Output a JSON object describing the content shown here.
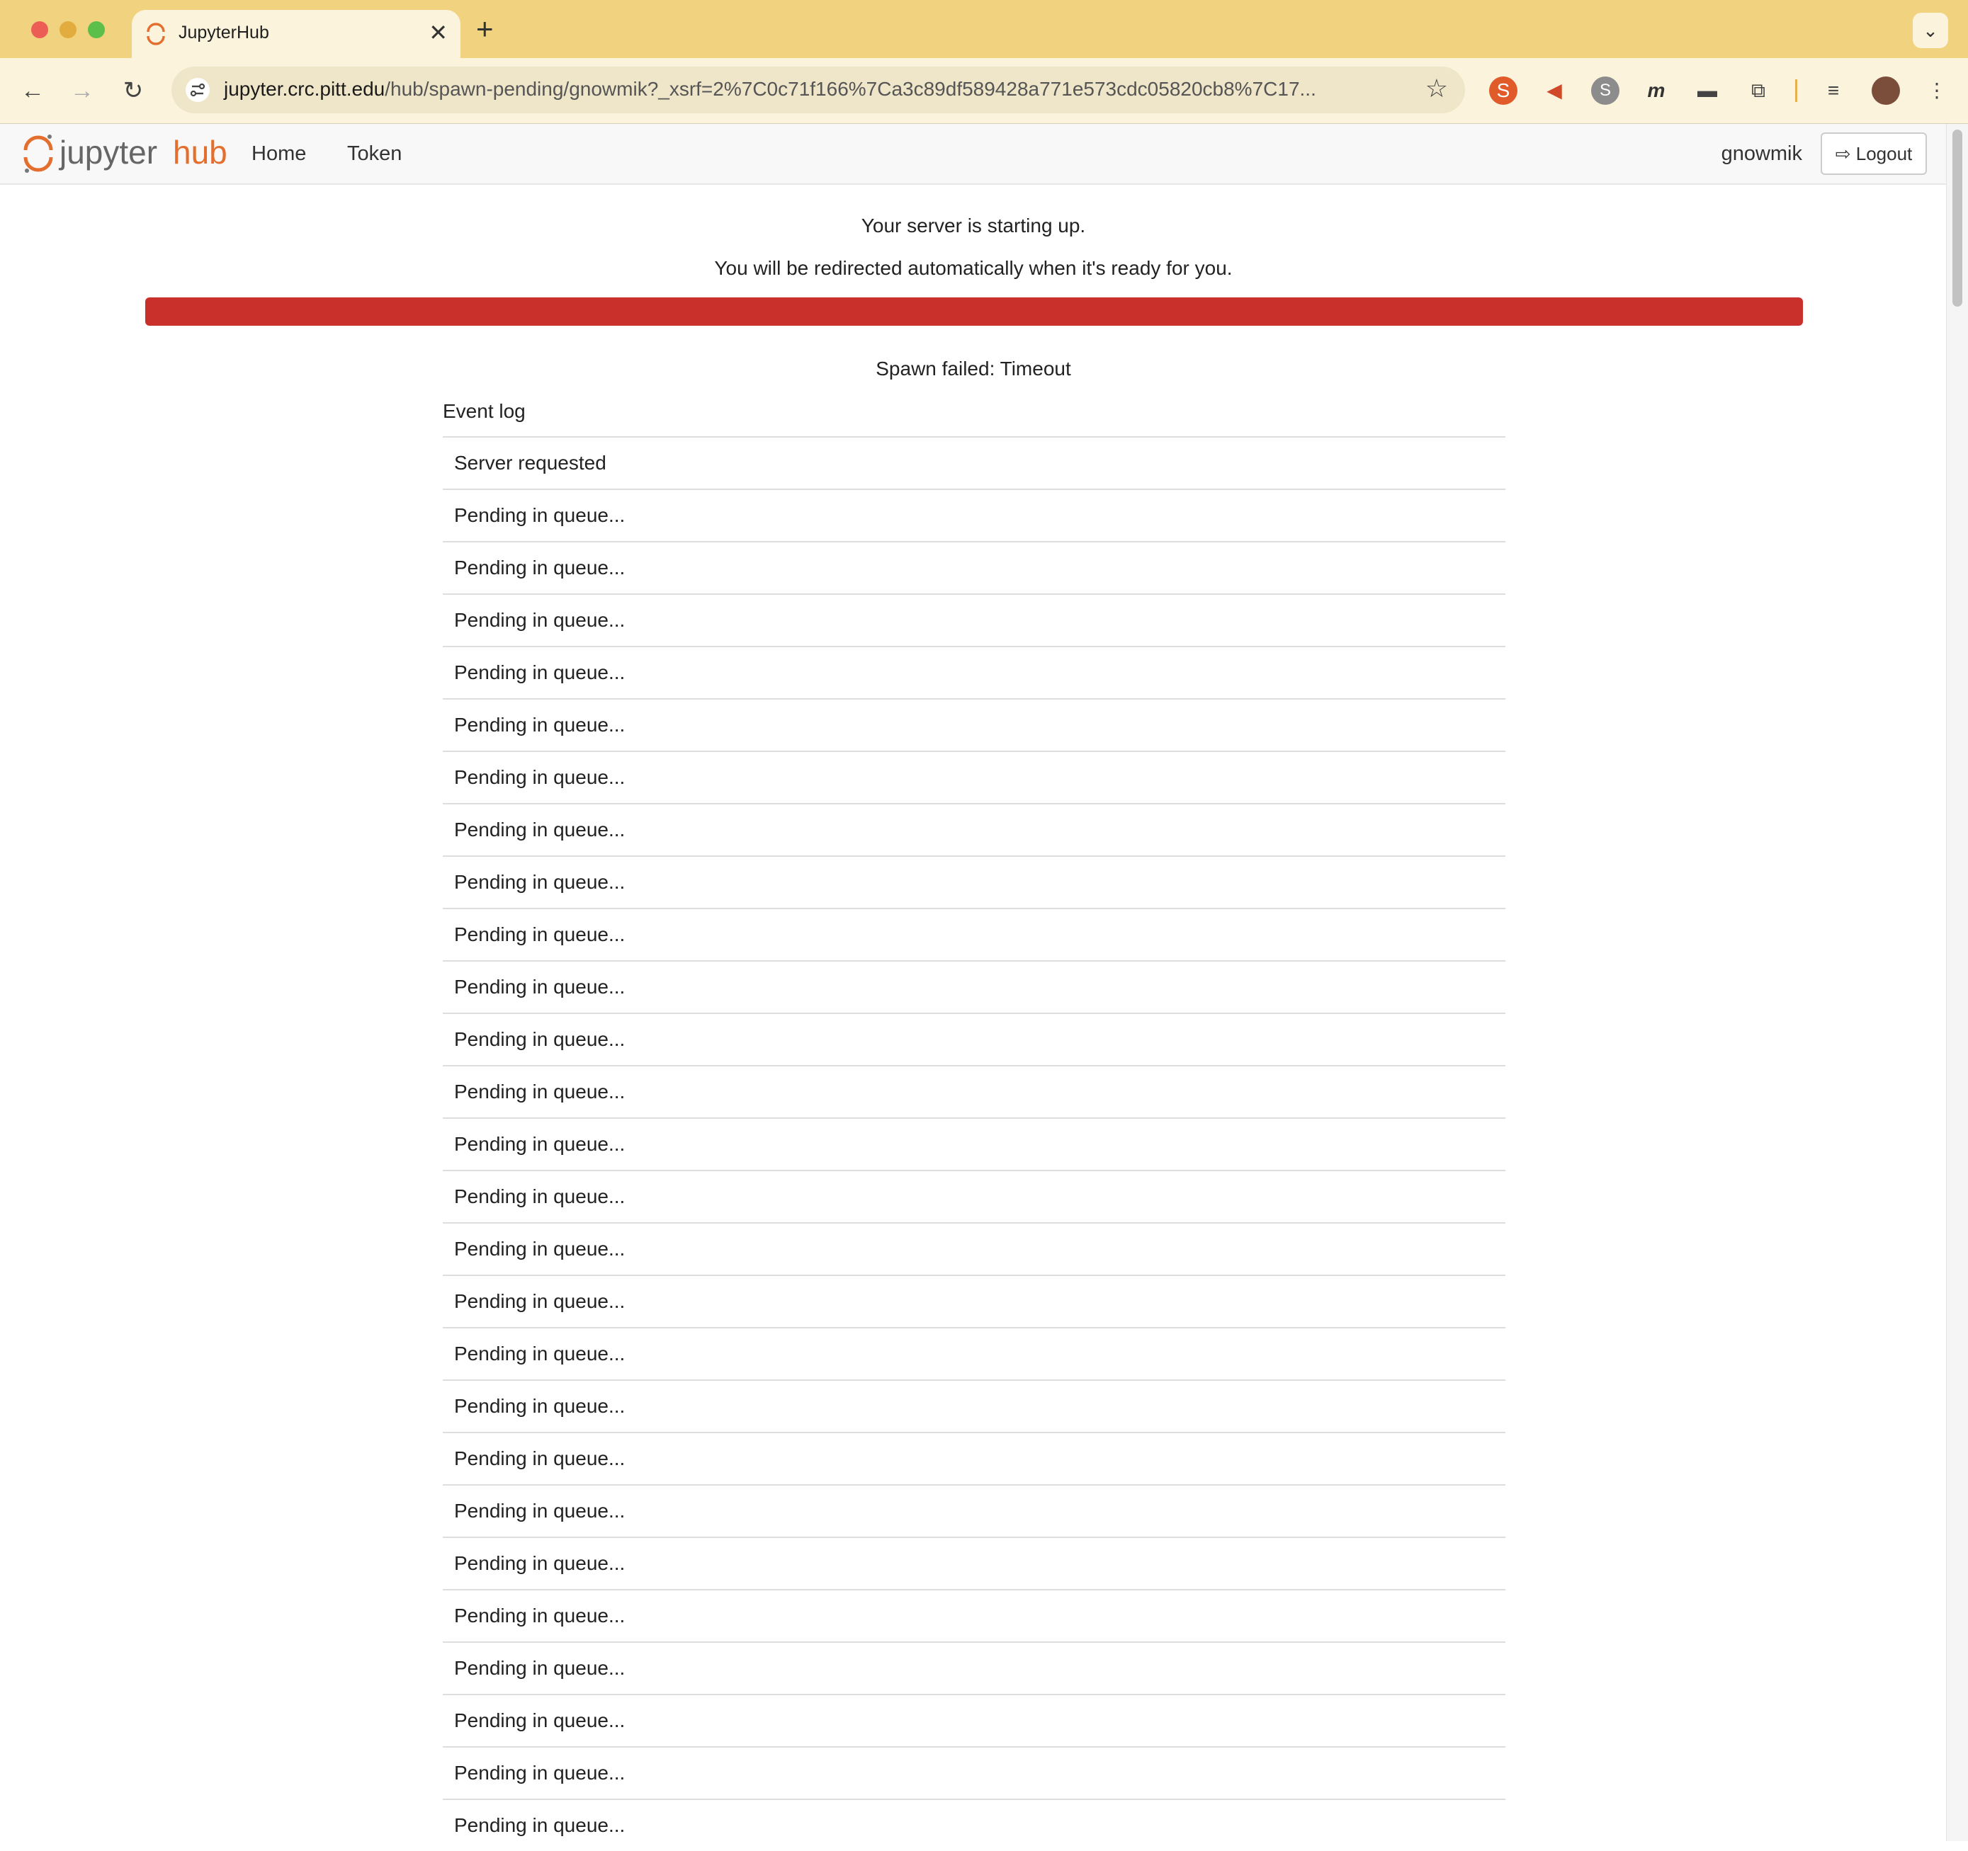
{
  "browser": {
    "tab_title": "JupyterHub",
    "tab_close": "✕",
    "new_tab": "+",
    "tab_menu": "⌄",
    "url_host": "jupyter.crc.pitt.edu",
    "url_path": "/hub/spawn-pending/gnowmik?_xsrf=2%7C0c71f166%7Ca3c89df589428a771e573cdc05820cb8%7C17...",
    "back": "←",
    "forward": "→",
    "reload": "↻",
    "star": "☆",
    "menu": "⋮",
    "accent_color": "#f0d27f"
  },
  "navbar": {
    "logo_jupyter": "jupyter",
    "logo_hub": "hub",
    "home_label": "Home",
    "token_label": "Token",
    "username": "gnowmik",
    "logout_label": "Logout",
    "logout_icon": "⇨"
  },
  "main": {
    "starting_message": "Your server is starting up.",
    "redirect_message": "You will be redirected automatically when it's ready for you.",
    "progress_percent": 100,
    "progress_color": "#c9302c",
    "spawn_status": "Spawn failed: Timeout",
    "event_log_title": "Event log",
    "events": [
      "Server requested",
      "Pending in queue...",
      "Pending in queue...",
      "Pending in queue...",
      "Pending in queue...",
      "Pending in queue...",
      "Pending in queue...",
      "Pending in queue...",
      "Pending in queue...",
      "Pending in queue...",
      "Pending in queue...",
      "Pending in queue...",
      "Pending in queue...",
      "Pending in queue...",
      "Pending in queue...",
      "Pending in queue...",
      "Pending in queue...",
      "Pending in queue...",
      "Pending in queue...",
      "Pending in queue...",
      "Pending in queue...",
      "Pending in queue...",
      "Pending in queue...",
      "Pending in queue...",
      "Pending in queue...",
      "Pending in queue...",
      "Pending in queue..."
    ]
  }
}
